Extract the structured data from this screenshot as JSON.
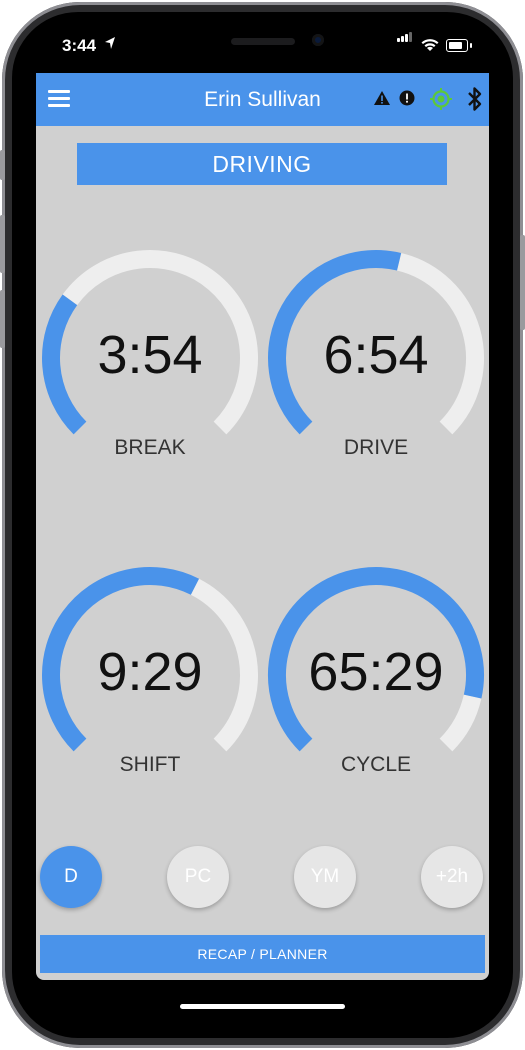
{
  "status_bar": {
    "time": "3:44"
  },
  "header": {
    "title": "Erin Sullivan"
  },
  "duty_status": "DRIVING",
  "gauges": [
    {
      "value": "3:54",
      "label": "BREAK",
      "progress": 0.3
    },
    {
      "value": "6:54",
      "label": "DRIVE",
      "progress": 0.55
    },
    {
      "value": "9:29",
      "label": "SHIFT",
      "progress": 0.6
    },
    {
      "value": "65:29",
      "label": "CYCLE",
      "progress": 0.88
    }
  ],
  "modes": [
    {
      "label": "D",
      "active": true
    },
    {
      "label": "PC",
      "active": false
    },
    {
      "label": "YM",
      "active": false
    },
    {
      "label": "+2h",
      "active": false
    }
  ],
  "recap_button": "RECAP / PLANNER",
  "colors": {
    "accent": "#4a93ea",
    "track": "#eeeeee",
    "background": "#d0d0d0",
    "gps": "#5cc93a"
  },
  "icons": [
    "menu-icon",
    "warning-icon",
    "error-icon",
    "gps-icon",
    "bluetooth-icon"
  ]
}
